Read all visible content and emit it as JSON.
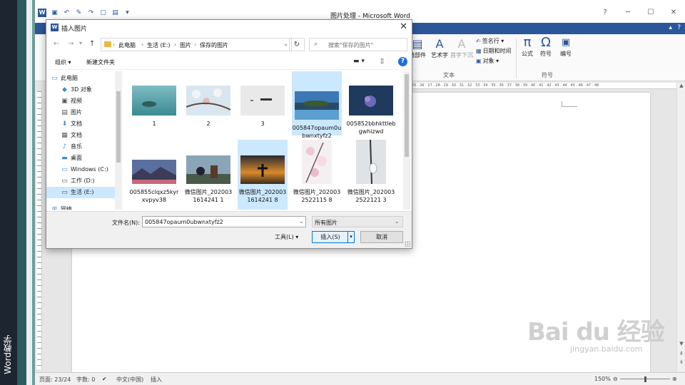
{
  "side_label": "Word教学",
  "word": {
    "title": "图片处理 - Microsoft Word",
    "ribbon": {
      "groups": [
        {
          "name": "文本",
          "items": [
            "艺术字",
            "首字下沉",
            "签名行",
            "日期和时间",
            "对象"
          ]
        },
        {
          "name": "符号",
          "items": [
            "公式",
            "符号",
            "编号"
          ]
        }
      ],
      "partial_label": "档部件"
    },
    "ruler_numbers": "25 · 26 · 27 · 28 · 29 · 30 · 31 · 32 · 33 · 34 · 35 · 36 · 37 · 38 · 39 · 40 · 41 · 42 · 43 · 44 · 45 · 46 · 47 · 48",
    "status": {
      "page": "页面: 23/24",
      "words": "字数: 0",
      "language": "中文(中国)",
      "mode": "插入",
      "zoom": "150%",
      "zoom_level": 0.55
    }
  },
  "dialog": {
    "title": "插入图片",
    "breadcrumbs": [
      "此电脑",
      "生活 (E:)",
      "图片",
      "保存的图片"
    ],
    "search_placeholder": "搜索\"保存的图片\"",
    "toolbar": {
      "organize": "组织 ▾",
      "new_folder": "新建文件夹"
    },
    "nav_items": [
      {
        "label": "此电脑",
        "icon": "computer-icon"
      },
      {
        "label": "3D 对象",
        "icon": "3d-objects-icon"
      },
      {
        "label": "视频",
        "icon": "video-icon"
      },
      {
        "label": "图片",
        "icon": "pictures-icon"
      },
      {
        "label": "文档",
        "icon": "downloads-icon"
      },
      {
        "label": "文档",
        "icon": "documents-icon"
      },
      {
        "label": "音乐",
        "icon": "music-icon"
      },
      {
        "label": "桌面",
        "icon": "desktop-icon"
      },
      {
        "label": "Windows (C:)",
        "icon": "drive-icon"
      },
      {
        "label": "工作 (D:)",
        "icon": "drive-icon"
      },
      {
        "label": "生活 (E:)",
        "icon": "drive-icon",
        "selected": true
      },
      {
        "label": "网络",
        "icon": "network-icon"
      }
    ],
    "files": [
      {
        "name": "1",
        "selected": false
      },
      {
        "name": "2",
        "selected": false
      },
      {
        "name": "3",
        "selected": false
      },
      {
        "name": "005847opaum0ubwnxtyfz2",
        "selected": true
      },
      {
        "name": "005852bbhkttlebgwhizwd",
        "selected": false
      },
      {
        "name": "005855clqxz5kyrxvpyv38",
        "selected": false
      },
      {
        "name": "微信图片_2020031614241 1",
        "selected": false
      },
      {
        "name": "微信图片_2020031614241 8",
        "selected": true
      },
      {
        "name": "微信图片_2020032522115 8",
        "selected": false
      },
      {
        "name": "微信图片_2020032522121 3",
        "selected": false
      }
    ],
    "filename_label": "文件名(N):",
    "filename_value": "005847opaum0ubwnxtyfz2",
    "filetype_value": "所有图片",
    "tools_label": "工具(L)",
    "insert_label": "插入(S)",
    "cancel_label": "取消"
  },
  "watermark": {
    "main": "Bai du 经验",
    "sub": "jingyan.baidu.com"
  },
  "colors": {
    "word_blue": "#2b579a",
    "selection": "#cce8ff",
    "accent": "#0078d7"
  }
}
